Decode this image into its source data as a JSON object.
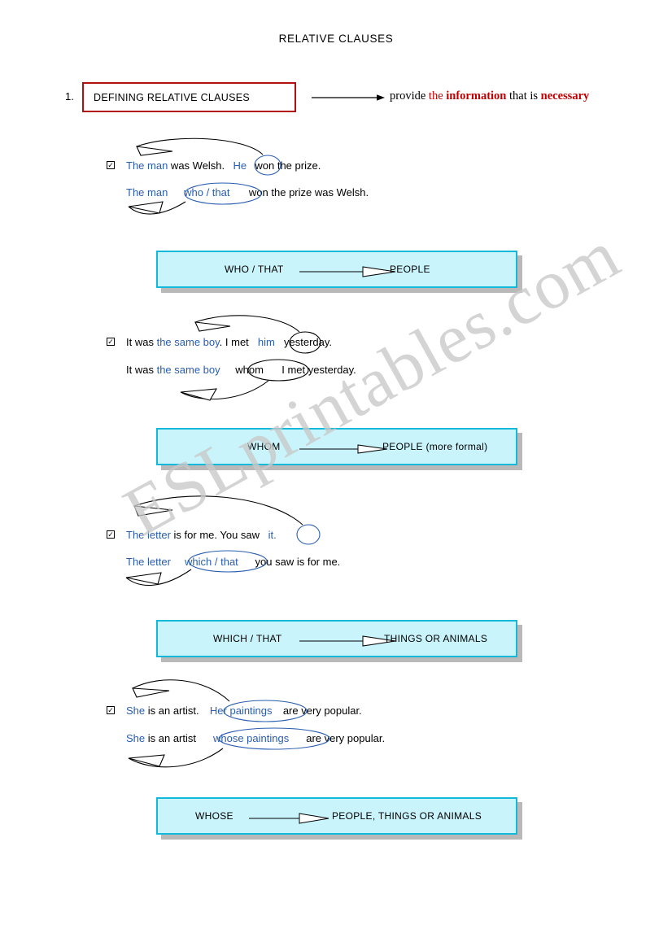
{
  "document": {
    "title": "RELATIVE CLAUSES",
    "watermark": "ESLprintables.com"
  },
  "section": {
    "number": "1.",
    "boxed_heading": "DEFINING RELATIVE CLAUSES",
    "arrow_icon": "right-arrow-icon",
    "description": {
      "prefix": "provide ",
      "highlight_1": "the",
      "highlight_1_bold": " information",
      "middle": " that is ",
      "highlight_2": "necessary"
    }
  },
  "examples": [
    {
      "id": "who-that",
      "line1": {
        "part1": "The man",
        "part2": " was Welsh.  ",
        "pronoun": "He",
        "part3": " won the prize."
      },
      "line2": {
        "part1": "The man",
        "relative": "who / that",
        "part2": " won the prize was Welsh."
      },
      "rule": {
        "left": "WHO / THAT",
        "right": "PEOPLE",
        "arrow_icon": "block-arrow-icon"
      }
    },
    {
      "id": "whom",
      "line1": {
        "prefix": "It was ",
        "subject": "the same boy",
        "part2": ". I met ",
        "pronoun": "him",
        "part3": " yesterday."
      },
      "line2": {
        "prefix": "It was ",
        "subject": "the same boy",
        "relative": "whom",
        "part2": " I met yesterday."
      },
      "rule": {
        "left": "WHOM",
        "right": "PEOPLE (more formal)",
        "arrow_icon": "block-arrow-icon"
      }
    },
    {
      "id": "which-that",
      "line1": {
        "part1": "The letter",
        "part2": " is for me. You saw ",
        "pronoun": "it.",
        "part3": ""
      },
      "line2": {
        "part1": "The letter",
        "relative": "which / that",
        "part2": " you saw is for me."
      },
      "rule": {
        "left": "WHICH / THAT",
        "right": "THINGS OR ANIMALS",
        "arrow_icon": "block-arrow-icon"
      }
    },
    {
      "id": "whose",
      "line1": {
        "part1": "She",
        "part2": " is an artist. ",
        "pronoun": "Her paintings",
        "part3": " are very popular."
      },
      "line2": {
        "part1": "She",
        "part1b": " is an artist ",
        "relative": "whose paintings",
        "part2": " are very popular."
      },
      "rule": {
        "left": "WHOSE",
        "right": "PEOPLE, THINGS OR ANIMALS",
        "arrow_icon": "block-arrow-icon"
      }
    }
  ],
  "colors": {
    "accent_cyan_fill": "#c9f4fb",
    "accent_cyan_border": "#13b9d8",
    "heading_box_border": "#b01010",
    "blue_text": "#2a5db0",
    "red_text": "#c00000"
  }
}
